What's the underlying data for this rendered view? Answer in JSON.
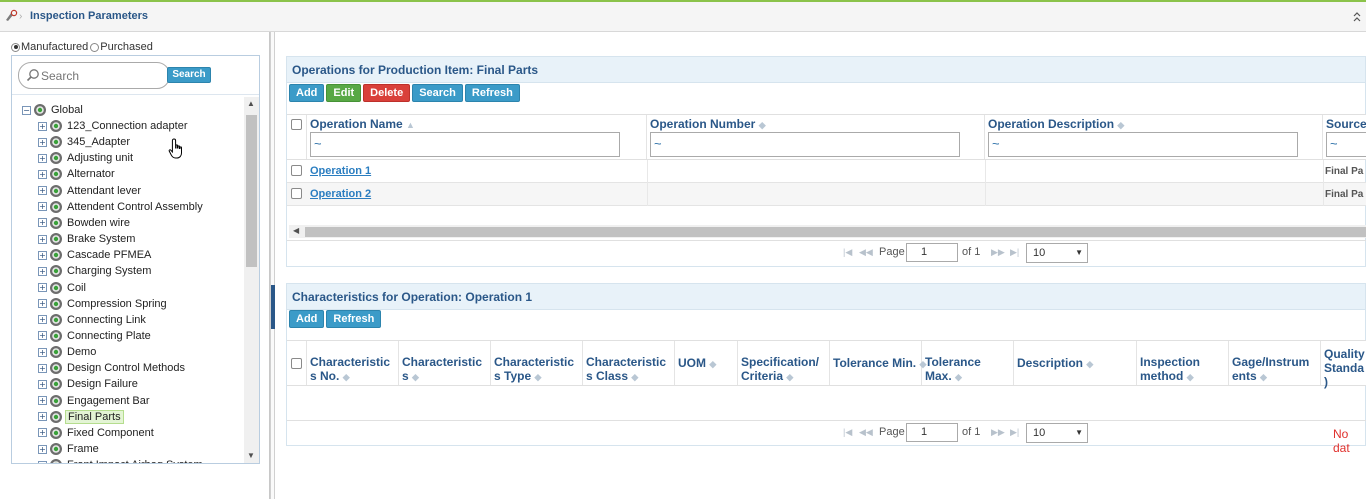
{
  "header": {
    "title": "Inspection Parameters"
  },
  "left": {
    "radio_manufactured": "Manufactured",
    "radio_purchased": "Purchased",
    "search_placeholder": "Search",
    "search_button": "Search",
    "tree": {
      "root": "Global",
      "items": [
        "123_Connection adapter",
        "345_Adapter",
        "Adjusting unit",
        "Alternator",
        "Attendant lever",
        "Attendent Control Assembly",
        "Bowden wire",
        "Brake System",
        "Cascade PFMEA",
        "Charging System",
        "Coil",
        "Compression Spring",
        "Connecting Link",
        "Connecting Plate",
        "Demo",
        "Design Control Methods",
        "Design Failure",
        "Engagement Bar",
        "Final Parts",
        "Fixed Component",
        "Frame",
        "Front Impact Airbag System"
      ],
      "selected": "Final Parts"
    }
  },
  "operations": {
    "title": "Operations for Production Item: Final Parts",
    "buttons": {
      "add": "Add",
      "edit": "Edit",
      "delete": "Delete",
      "search": "Search",
      "refresh": "Refresh"
    },
    "columns": [
      "Operation Name",
      "Operation Number",
      "Operation Description",
      "Source"
    ],
    "filter_symbol": "~",
    "rows": [
      {
        "name": "Operation 1",
        "source": "Final Pa"
      },
      {
        "name": "Operation 2",
        "source": "Final Pa"
      }
    ],
    "pager": {
      "page_label": "Page",
      "page": "1",
      "of_label": "of 1",
      "page_size": "10"
    }
  },
  "characteristics": {
    "title": "Characteristics for Operation: Operation 1",
    "buttons": {
      "add": "Add",
      "refresh": "Refresh"
    },
    "columns": [
      {
        "l1": "Characteristic",
        "l2": "s No."
      },
      {
        "l1": "Characteristic",
        "l2": "s"
      },
      {
        "l1": "Characteristic",
        "l2": "s Type"
      },
      {
        "l1": "Characteristic",
        "l2": "s Class"
      },
      {
        "l1": "UOM",
        "l2": ""
      },
      {
        "l1": "Specification/",
        "l2": "Criteria"
      },
      {
        "l1": "Tolerance Min.",
        "l2": ""
      },
      {
        "l1": "Tolerance",
        "l2": "Max."
      },
      {
        "l1": "Description",
        "l2": ""
      },
      {
        "l1": "Inspection",
        "l2": "method"
      },
      {
        "l1": "Gage/Instrum",
        "l2": "ents"
      },
      {
        "l1": "Quality",
        "l2": "Standa",
        "l3": ")"
      }
    ],
    "pager": {
      "page_label": "Page",
      "page": "1",
      "of_label": "of 1",
      "page_size": "10"
    },
    "no_data": "No dat"
  },
  "colors": {
    "accent": "#2a5788",
    "button_blue": "#3b9bc8",
    "button_green": "#58a845",
    "button_red": "#d9403a",
    "selected_bg": "#e3f4d4",
    "top_border": "#8bc34a"
  }
}
